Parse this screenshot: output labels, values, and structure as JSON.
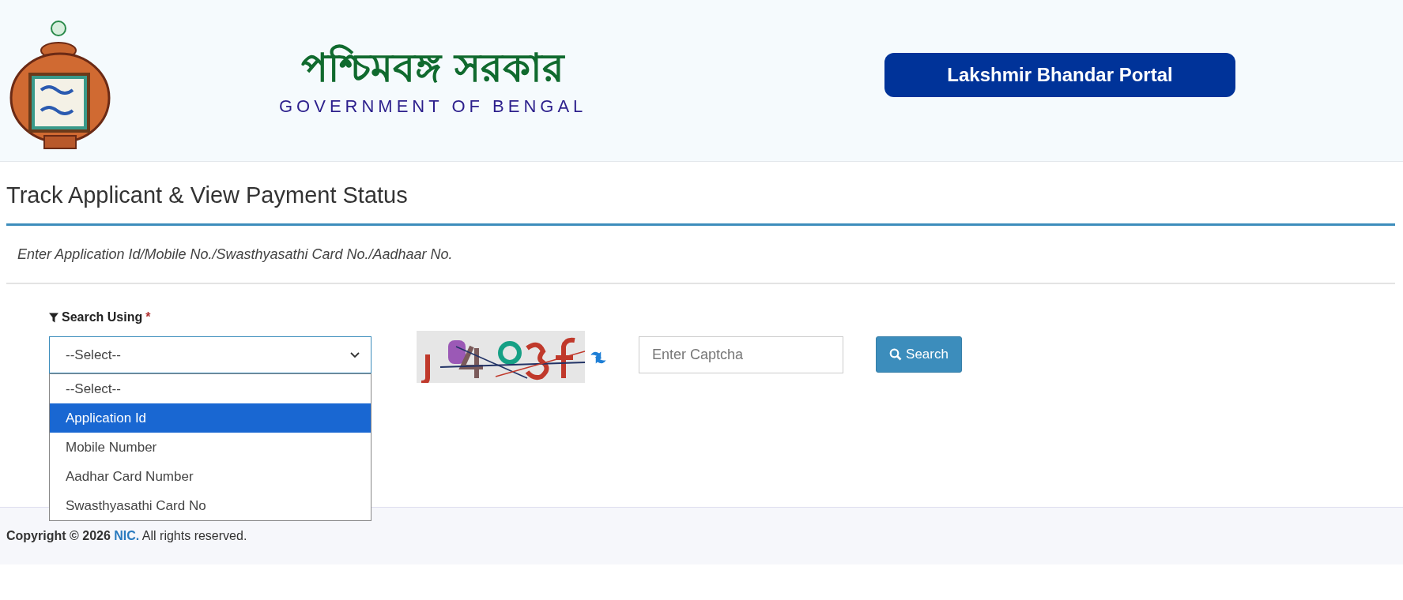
{
  "header": {
    "title_bengali": "পশ্চিমবঙ্গ সরকার",
    "subtitle": "GOVERNMENT OF BENGAL",
    "portal_button": "Lakshmir Bhandar Portal"
  },
  "page_title": "Track Applicant & View Payment Status",
  "instruction": "Enter Application Id/Mobile No./Swasthyasathi Card No./Aadhaar No.",
  "form": {
    "search_label": "Search Using",
    "required_mark": "*",
    "select_value": "--Select--",
    "dropdown_expanded": true,
    "options": [
      {
        "label": "--Select--",
        "selected": false
      },
      {
        "label": "Application Id",
        "selected": true
      },
      {
        "label": "Mobile Number",
        "selected": false
      },
      {
        "label": "Aadhar Card Number",
        "selected": false
      },
      {
        "label": "Swasthyasathi Card No",
        "selected": false
      }
    ],
    "captcha_placeholder": "Enter Captcha",
    "search_button": "Search"
  },
  "footer": {
    "prefix": "Copyright © 2026",
    "link": "NIC.",
    "suffix": "All rights reserved."
  }
}
